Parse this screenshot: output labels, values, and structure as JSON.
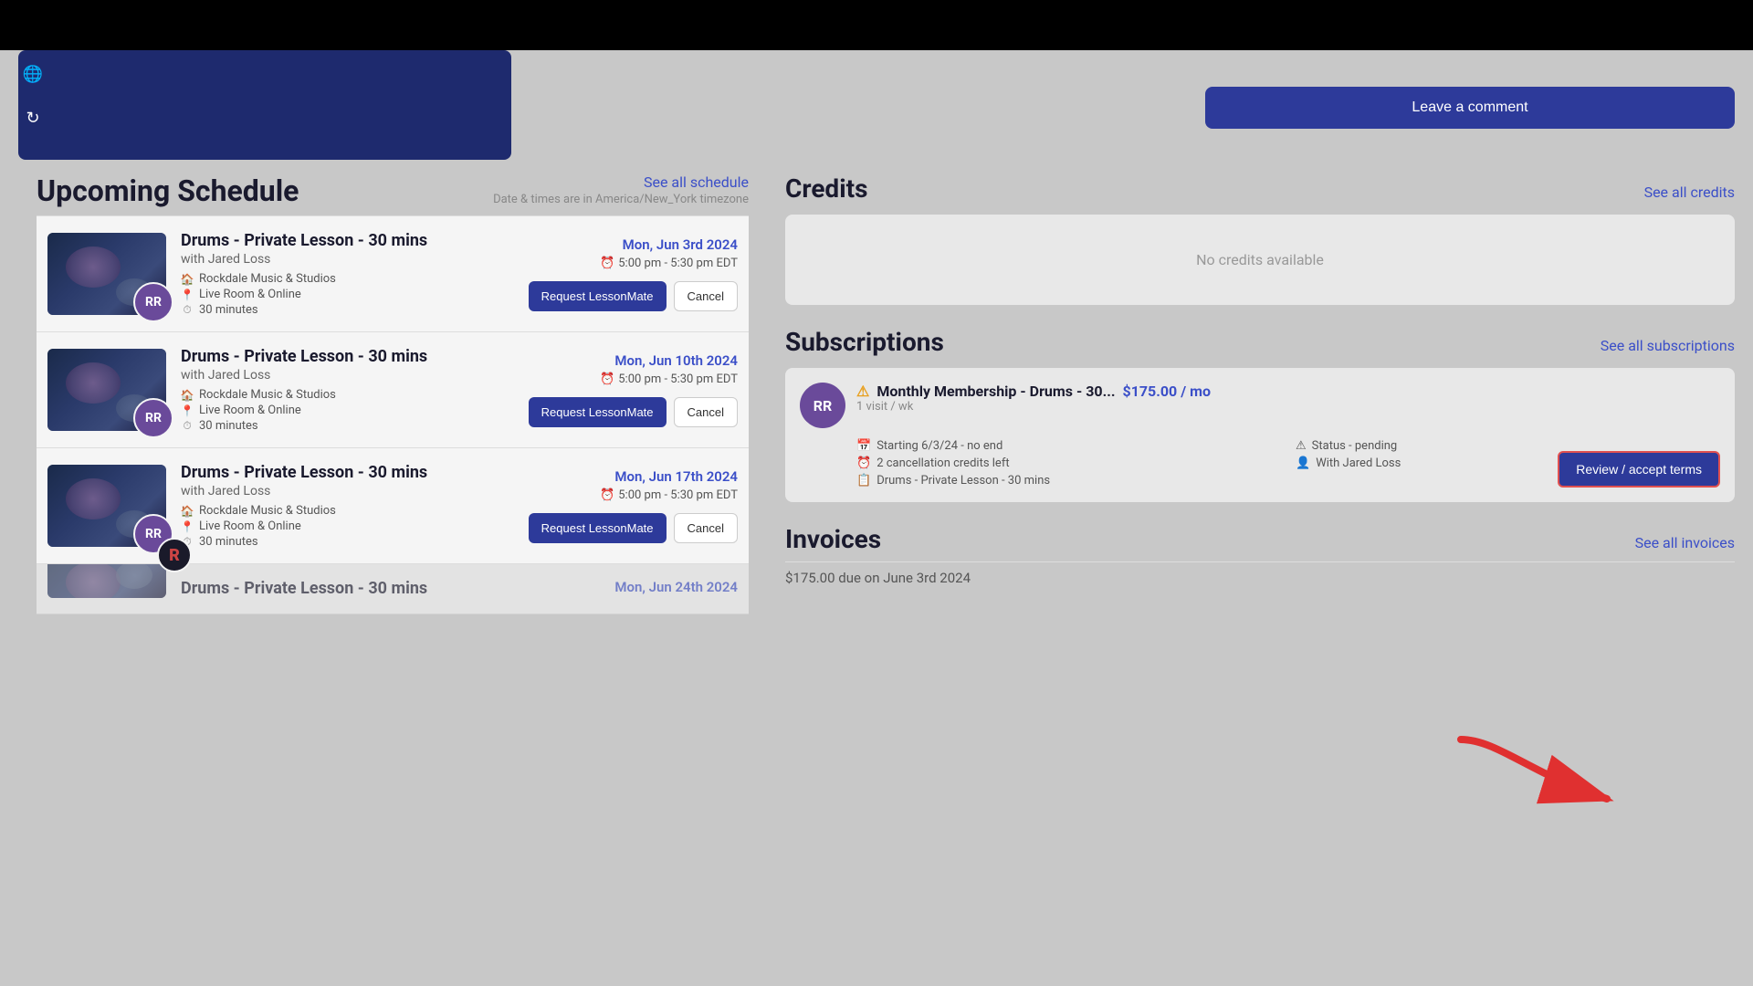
{
  "topBar": {
    "visible": true
  },
  "sidebar": {
    "globeIcon": "🌐",
    "refreshIcon": "↻"
  },
  "header": {
    "leaveCommentBtn": "Leave a comment"
  },
  "upcomingSchedule": {
    "title": "Upcoming Schedule",
    "seeAllLink": "See all schedule",
    "timezone": "Date & times are in America/New_York timezone",
    "lessons": [
      {
        "title": "Drums - Private Lesson - 30 mins",
        "instructor": "with Jared Loss",
        "location": "Rockdale Music & Studios",
        "room": "Live Room & Online",
        "duration": "30 minutes",
        "date": "Mon, Jun 3rd 2024",
        "time": "5:00 pm - 5:30 pm EDT",
        "avatar": "RR",
        "requestBtn": "Request LessonMate",
        "cancelBtn": "Cancel"
      },
      {
        "title": "Drums - Private Lesson - 30 mins",
        "instructor": "with Jared Loss",
        "location": "Rockdale Music & Studios",
        "room": "Live Room & Online",
        "duration": "30 minutes",
        "date": "Mon, Jun 10th 2024",
        "time": "5:00 pm - 5:30 pm EDT",
        "avatar": "RR",
        "requestBtn": "Request LessonMate",
        "cancelBtn": "Cancel"
      },
      {
        "title": "Drums - Private Lesson - 30 mins",
        "instructor": "with Jared Loss",
        "location": "Rockdale Music & Studios",
        "room": "Live Room & Online",
        "duration": "30 minutes",
        "date": "Mon, Jun 17th 2024",
        "time": "5:00 pm - 5:30 pm EDT",
        "avatar": "RR",
        "avatarDark": true,
        "requestBtn": "Request LessonMate",
        "cancelBtn": "Cancel"
      },
      {
        "title": "Drums - Private Lesson - 30 mins",
        "instructor": "",
        "date": "Mon, Jun 24th 2024",
        "partial": true
      }
    ]
  },
  "credits": {
    "title": "Credits",
    "seeAllLink": "See all credits",
    "noCreditsText": "No credits available"
  },
  "subscriptions": {
    "title": "Subscriptions",
    "seeAllLink": "See all subscriptions",
    "items": [
      {
        "avatar": "RR",
        "warningIcon": "⚠",
        "name": "Monthly Membership - Drums - 30...",
        "price": "$175.00 / mo",
        "frequency": "1 visit / wk",
        "startDate": "Starting 6/3/24 - no end",
        "status": "Status - pending",
        "cancellations": "2 cancellation credits left",
        "instructor": "With Jared Loss",
        "lessonType": "Drums - Private Lesson - 30 mins",
        "reviewBtn": "Review / accept terms"
      }
    ]
  },
  "invoices": {
    "title": "Invoices",
    "seeAllLink": "See all invoices",
    "items": [
      {
        "text": "$175.00 due on June 3rd 2024"
      }
    ]
  }
}
